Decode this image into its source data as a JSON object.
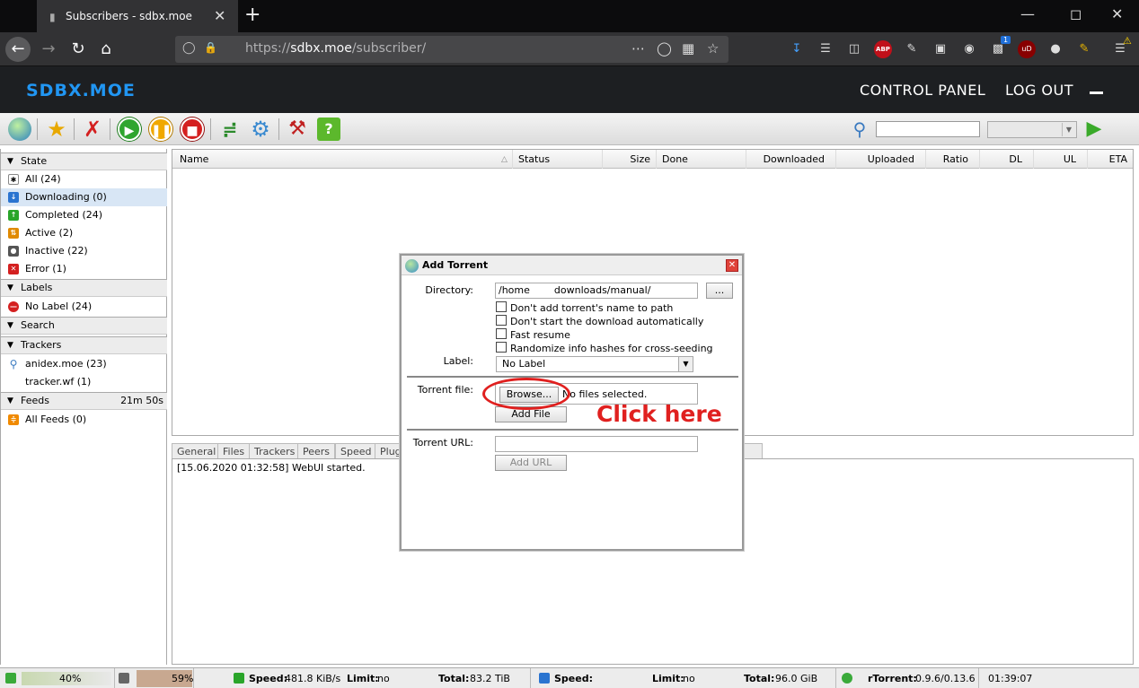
{
  "browser": {
    "tab_title": "Subscribers - sdbx.moe",
    "url_prefix": "https://",
    "url_domain": "sdbx.moe",
    "url_path": "/subscriber/",
    "badge_count": "1"
  },
  "site": {
    "brand": "SDBX.MOE",
    "control_panel": "CONTROL PANEL",
    "log_out": "LOG OUT"
  },
  "sidebar": {
    "state_header": "State",
    "state_items": [
      "All (24)",
      "Downloading (0)",
      "Completed (24)",
      "Active (2)",
      "Inactive (22)",
      "Error (1)"
    ],
    "labels_header": "Labels",
    "labels_items": [
      "No Label (24)"
    ],
    "search_header": "Search",
    "trackers_header": "Trackers",
    "trackers_items": [
      "anidex.moe (23)",
      "tracker.wf (1)"
    ],
    "feeds_header": "Feeds",
    "feeds_timer": "21m 50s",
    "feeds_items": [
      "All Feeds (0)"
    ]
  },
  "columns": [
    "Name",
    "Status",
    "Size",
    "Done",
    "Downloaded",
    "Uploaded",
    "Ratio",
    "DL",
    "UL",
    "ETA"
  ],
  "bottom_tabs": [
    "General",
    "Files",
    "Trackers",
    "Peers",
    "Speed",
    "Plug"
  ],
  "log": "[15.06.2020 01:32:58] WebUI started.",
  "dialog": {
    "title": "Add Torrent",
    "directory_label": "Directory:",
    "directory_value_a": "/home",
    "directory_value_b": "downloads/manual/",
    "dots_button": "...",
    "checkboxes": [
      "Don't add torrent's name to path",
      "Don't start the download automatically",
      "Fast resume",
      "Randomize info hashes for cross-seeding"
    ],
    "label_label": "Label:",
    "label_value": "No Label",
    "torrent_file_label": "Torrent file:",
    "browse_button": "Browse...",
    "no_files": "No files selected.",
    "add_file_button": "Add File",
    "torrent_url_label": "Torrent URL:",
    "add_url_button": "Add URL"
  },
  "annotation": "Click here",
  "statusbar": {
    "disk": "40%",
    "cpu": "59%",
    "ul_speed_label": "Speed:",
    "ul_speed": "481.8 KiB/s",
    "limit_label": "Limit:",
    "limit_no": "no",
    "total_label": "Total:",
    "ul_total": "83.2 TiB",
    "dl_speed_label": "Speed:",
    "dl_total": "96.0 GiB",
    "client_label": "rTorrent:",
    "client_version": "0.9.6/0.13.6",
    "clock": "01:39:07"
  },
  "colors": {
    "brand": "#2196f3",
    "annotation": "#e0201f"
  }
}
